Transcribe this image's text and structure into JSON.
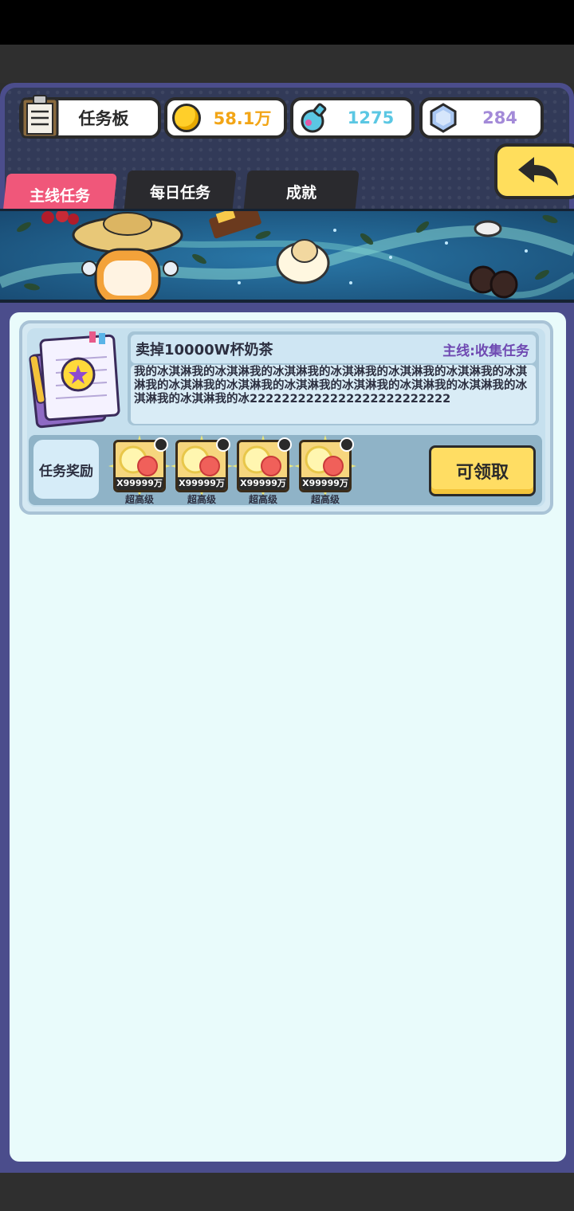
{
  "header": {
    "board_label": "任务板",
    "gold": "58.1万",
    "potion": "1275",
    "gem": "284",
    "colors": {
      "gold": "#f2a516",
      "potion": "#5bc7e3",
      "gem": "#a38ad8"
    }
  },
  "tabs": [
    {
      "label": "主线任务",
      "active": true
    },
    {
      "label": "每日任务",
      "active": false
    },
    {
      "label": "成就",
      "active": false
    }
  ],
  "task": {
    "title": "卖掉10000W杯奶茶",
    "type": "主线:收集任务",
    "description": "我的冰淇淋我的冰淇淋我的冰淇淋我的冰淇淋我的冰淇淋我的冰淇淋我的冰淇淋我的冰淇淋我的冰淇淋我的冰淇淋我的冰淇淋我的冰淇淋我的冰淇淋我的冰淇淋我的冰淇淋我的冰2222222222222222222222222",
    "reward_label": "任务奖励",
    "rewards": [
      {
        "qty": "X99999万",
        "grade": "超高级"
      },
      {
        "qty": "X99999万",
        "grade": "超高级"
      },
      {
        "qty": "X99999万",
        "grade": "超高级"
      },
      {
        "qty": "X99999万",
        "grade": "超高级"
      }
    ],
    "claim_label": "可领取"
  }
}
